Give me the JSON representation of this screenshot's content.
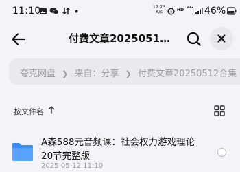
{
  "status_bar": {
    "time": "11:10",
    "net_speed_value": "17.73",
    "net_speed_unit": "K/s",
    "hd_label": "HD",
    "network_type": "4G",
    "battery": "46%"
  },
  "header": {
    "title": "付费文章20250512...",
    "icons": [
      "arrow-left-icon",
      "search-icon",
      "close-icon"
    ]
  },
  "breadcrumb": {
    "items": [
      "夸克网盘",
      "来自：分享",
      "付费文章20250512合集"
    ]
  },
  "sort": {
    "label": "按文件名"
  },
  "files": [
    {
      "name": "A森588元音频课：社会权力游戏理论20节完整版",
      "date": "2025-05-12 11:10",
      "icon": "folder-icon"
    }
  ],
  "colors": {
    "background": "#f3f4f7",
    "folder": "#3a8cf5",
    "breadcrumb_bg": "#e8eaee"
  }
}
